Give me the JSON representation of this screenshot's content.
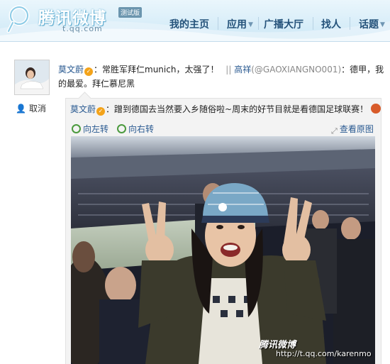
{
  "header": {
    "logo_text": "腾讯微博",
    "beta_badge": "测试版",
    "logo_url": "t.qq.com",
    "nav": [
      {
        "label": "我的主页"
      },
      {
        "label": "应用",
        "dropdown": true
      },
      {
        "label": "广播大厅"
      },
      {
        "label": "找人"
      },
      {
        "label": "话题",
        "dropdown": true
      }
    ]
  },
  "sidebar": {
    "unlisten_label": "取消"
  },
  "post": {
    "author": "莫文蔚",
    "text": "：常胜军拜仁munich，太强了！",
    "forward_sep": "||",
    "forward_author": "高祥",
    "forward_handle": "(@GAOXIANGNO001)",
    "forward_text": "：德甲，我的最爱。拜仁慕尼黑"
  },
  "quoted": {
    "author": "莫文蔚",
    "text": "：蹭到德国去当然要入乡随俗啦~周末的好节目就是看德国足球联赛！"
  },
  "image_toolbar": {
    "rotate_left": "向左转",
    "rotate_right": "向右转",
    "view_full": "查看原图"
  },
  "watermark": {
    "brand": "腾讯微博",
    "url": "http://t.qq.com/karenmo"
  },
  "colors": {
    "link_blue": "#2a5a91",
    "nav_blue": "#24527a",
    "verified_orange": "#f3a31a"
  }
}
